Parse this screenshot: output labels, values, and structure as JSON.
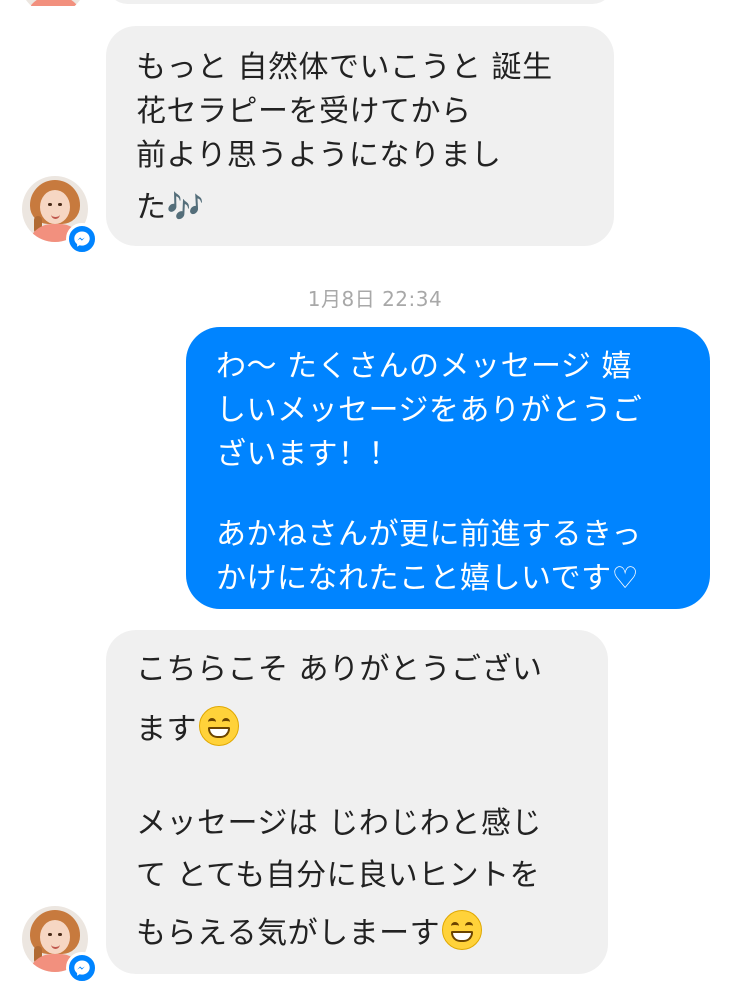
{
  "messages": [
    {
      "direction": "incoming",
      "lines": [
        "もっと 自然体でいこうと 誕生",
        "花セラピーを受けてから",
        "前より思うようになりまし",
        "た🎶"
      ]
    },
    {
      "direction": "outgoing",
      "lines": [
        "わ〜 たくさんのメッセージ 嬉",
        "しいメッセージをありがとうご",
        "ざいます！！",
        "",
        "あかねさんが更に前進するきっ",
        "かけになれたこと嬉しいです♡"
      ]
    },
    {
      "direction": "incoming",
      "lines": [
        "こちらこそ ありがとうござい",
        "ます",
        "",
        "メッセージは じわじわと感じ",
        "て とても自分に良いヒントを",
        "もらえる気がしまーす"
      ]
    }
  ],
  "timestamp": "1月8日 22:34",
  "emoji": "grinning-face",
  "colors": {
    "incoming_bubble": "#f0f0f0",
    "outgoing_bubble": "#0084ff",
    "messenger_badge": "#0084ff",
    "timestamp_text": "#a8a8a8"
  },
  "icons": {
    "avatar": "user-avatar",
    "badge": "messenger-icon"
  }
}
